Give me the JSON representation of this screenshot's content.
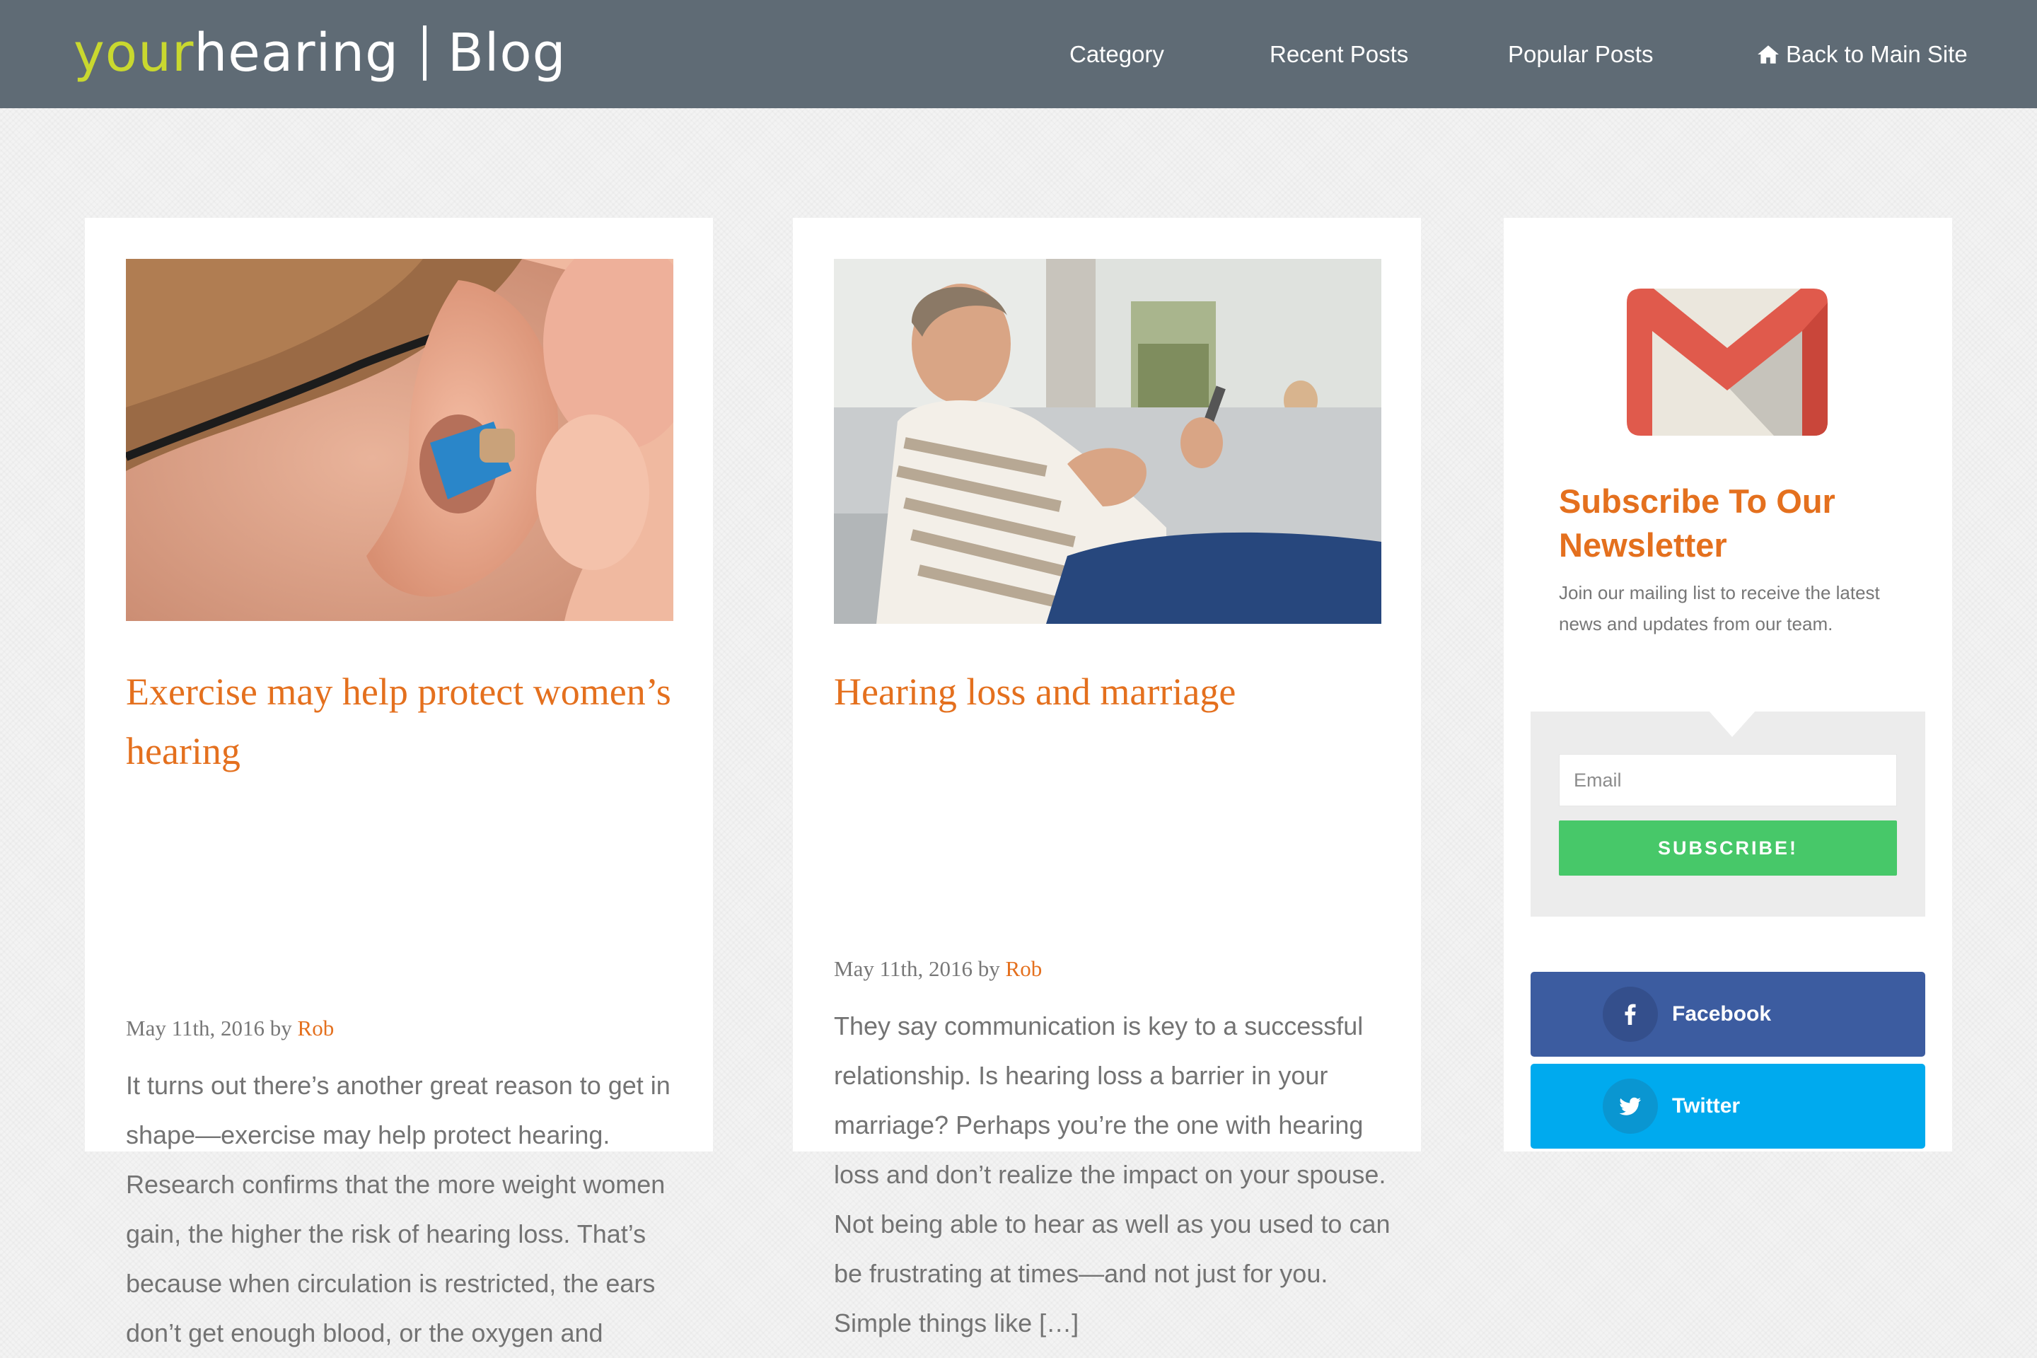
{
  "header": {
    "logo_your": "your",
    "logo_hearing": "hearing",
    "logo_blog": "Blog",
    "nav": {
      "category": "Category",
      "recent_posts": "Recent Posts",
      "popular_posts": "Popular Posts",
      "back_to_main_site": "Back to Main Site",
      "back_icon": "home-icon"
    }
  },
  "posts": [
    {
      "title": "Exercise may help protect women’s hearing",
      "date": "May 11th, 2016",
      "by": "by",
      "author": "Rob",
      "excerpt": "It turns out there’s another great reason to get in shape—exercise may help protect hearing. Research confirms that the more weight women gain, the higher the risk of hearing loss. That’s because when circulation is restricted, the ears don’t get enough blood, or the oxygen and",
      "image": "hearing-aid-insertion-photo"
    },
    {
      "title": "Hearing loss and marriage",
      "date": "May 11th, 2016",
      "by": "by",
      "author": "Rob",
      "excerpt": "They say communication is key to a successful relationship. Is hearing loss a barrier in your marriage? Perhaps you’re the one with hearing loss and don’t realize the impact on your spouse. Not being able to hear as well as you used to can be frustrating at times—and not just for you. Simple things like […]",
      "image": "man-on-couch-with-phone-photo"
    }
  ],
  "sidebar": {
    "icon": "gmail-envelope-icon",
    "title": "Subscribe To Our Newsletter",
    "text": "Join our mailing list to receive the latest news and updates from our team.",
    "email_placeholder": "Email",
    "subscribe_label": "SUBSCRIBE!",
    "social": [
      {
        "label": "Facebook",
        "icon": "facebook-icon",
        "color": "#3c5ca0"
      },
      {
        "label": "Twitter",
        "icon": "twitter-icon",
        "color": "#00aaee"
      }
    ]
  },
  "colors": {
    "header_bg": "#5f6b75",
    "logo_accent": "#c9d82f",
    "accent_orange": "#e4701e",
    "subscribe_green": "#47c869"
  }
}
